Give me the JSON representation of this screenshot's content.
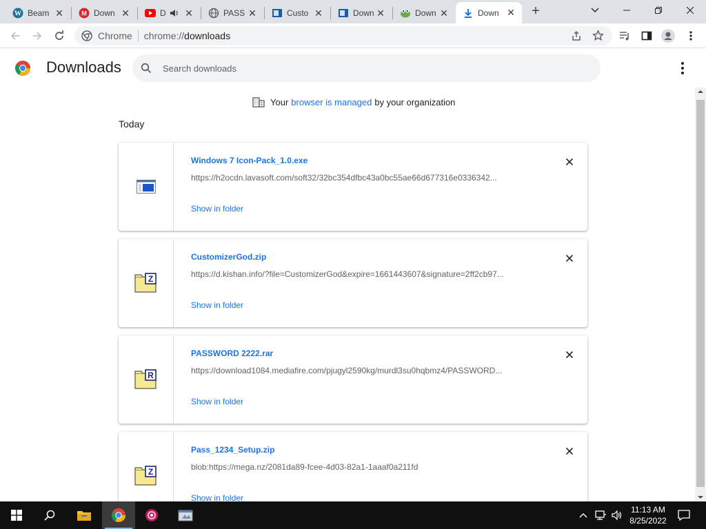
{
  "tabs": [
    {
      "label": "Beam",
      "favicon": "wordpress-icon"
    },
    {
      "label": "Down",
      "favicon": "mega-icon"
    },
    {
      "label": "D",
      "favicon": "youtube-icon"
    },
    {
      "label": "PASS",
      "favicon": "globe-icon"
    },
    {
      "label": "Custo",
      "favicon": "app-icon"
    },
    {
      "label": "Down",
      "favicon": "app-icon"
    },
    {
      "label": "Down",
      "favicon": "frog-icon"
    },
    {
      "label": "Down",
      "favicon": "download-icon",
      "active": true
    }
  ],
  "omnibox": {
    "chip": "Chrome",
    "scheme": "chrome://",
    "host": "downloads"
  },
  "page": {
    "title": "Downloads",
    "search_placeholder": "Search downloads",
    "managed": {
      "prefix": "Your",
      "link": "browser is managed",
      "suffix": "by your organization"
    },
    "section": "Today"
  },
  "downloads": [
    {
      "name": "Windows 7 Icon-Pack_1.0.exe",
      "url": "https://h2ocdn.lavasoft.com/soft32/32bc354dfbc43a0bc55ae66d677316e0336342...",
      "action": "Show in folder",
      "icon": "exe-file-icon"
    },
    {
      "name": "CustomizerGod.zip",
      "url": "https://d.kishan.info/?file=CustomizerGod&expire=1661443607&signature=2ff2cb97...",
      "action": "Show in folder",
      "icon": "zip-file-icon",
      "badge": "Z"
    },
    {
      "name": "PASSWORD 2222.rar",
      "url": "https://download1084.mediafire.com/pjugyl2590kg/murdl3su0hqbmz4/PASSWORD...",
      "action": "Show in folder",
      "icon": "rar-file-icon",
      "badge": "R"
    },
    {
      "name": "Pass_1234_Setup.zip",
      "url": "blob:https://mega.nz/2081da89-fcee-4d03-82a1-1aaaf0a211fd",
      "action": "Show in folder",
      "icon": "zip-file-icon",
      "badge": "Z"
    }
  ],
  "taskbar": {
    "time": "11:13 AM",
    "date": "8/25/2022"
  },
  "colors": {
    "accent": "#1a73e8",
    "tabstrip": "#dee1e6",
    "taskbar": "#101010"
  }
}
